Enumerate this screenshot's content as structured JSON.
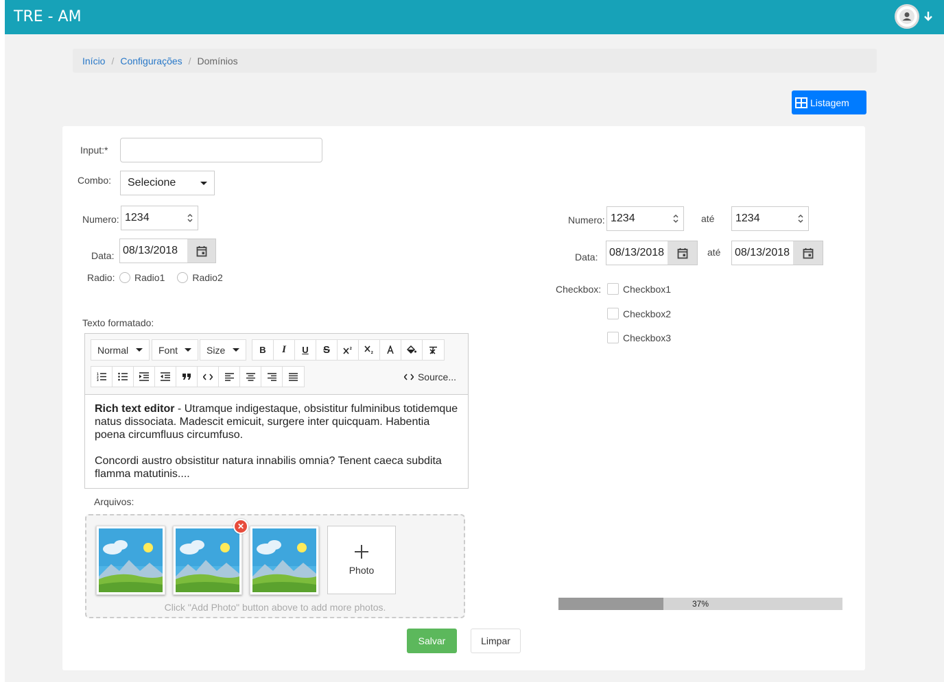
{
  "app": {
    "title": "TRE - AM"
  },
  "header": {
    "user_icon": "user-avatar-icon",
    "menu_icon": "arrow-down-icon"
  },
  "breadcrumb": {
    "items": [
      "Início",
      "Configurações"
    ],
    "current": "Domínios",
    "separator": "/"
  },
  "actions": {
    "listagem_label": "Listagem",
    "listagem_icon": "table-icon"
  },
  "form": {
    "input_label": "Input:*",
    "input_value": "",
    "combo_label": "Combo:",
    "combo_value": "Selecione",
    "numero_label": "Numero:",
    "numero_value": "1234",
    "data_label": "Data:",
    "data_value": "08/13/2018",
    "radio_label": "Radio:",
    "radio_options": [
      "Radio1",
      "Radio2"
    ],
    "range": {
      "numero_label": "Numero:",
      "numero_from": "1234",
      "ate_label": "até",
      "numero_to": "1234",
      "data_label": "Data:",
      "data_from": "08/13/2018",
      "data_to": "08/13/2018"
    },
    "checkbox_label": "Checkbox:",
    "checkbox_options": [
      "Checkbox1",
      "Checkbox2",
      "Checkbox3"
    ],
    "texto_label": "Texto formatado:",
    "editor": {
      "toolbar": {
        "format": "Normal",
        "font": "Font",
        "size": "Size",
        "bold": "B",
        "italic": "I",
        "underline": "U",
        "strike": "S",
        "source": "Source..."
      },
      "bold_lead": "Rich text editor",
      "para1_rest": " - Utramque indigestaque, obsistitur fulminibus totidemque natus dissociata. Madescit emicuit, surgere inter quicquam. Habentia poena circumfluus circumfuso.",
      "para2": "Concordi austro obsistitur natura innabilis omnia? Tenent caeca subdita flamma matutinis...."
    },
    "arquivos_label": "Arquivos:",
    "add_photo_label": "Photo",
    "upload_hint": "Click \"Add Photo\" button above to add more photos.",
    "salvar_label": "Salvar",
    "limpar_label": "Limpar"
  },
  "progress": {
    "value": 0.37,
    "label": "37%"
  },
  "colors": {
    "topbar": "#17a2b8",
    "primary": "#007bff",
    "success": "#5cb85c",
    "danger": "#e74c3c"
  }
}
